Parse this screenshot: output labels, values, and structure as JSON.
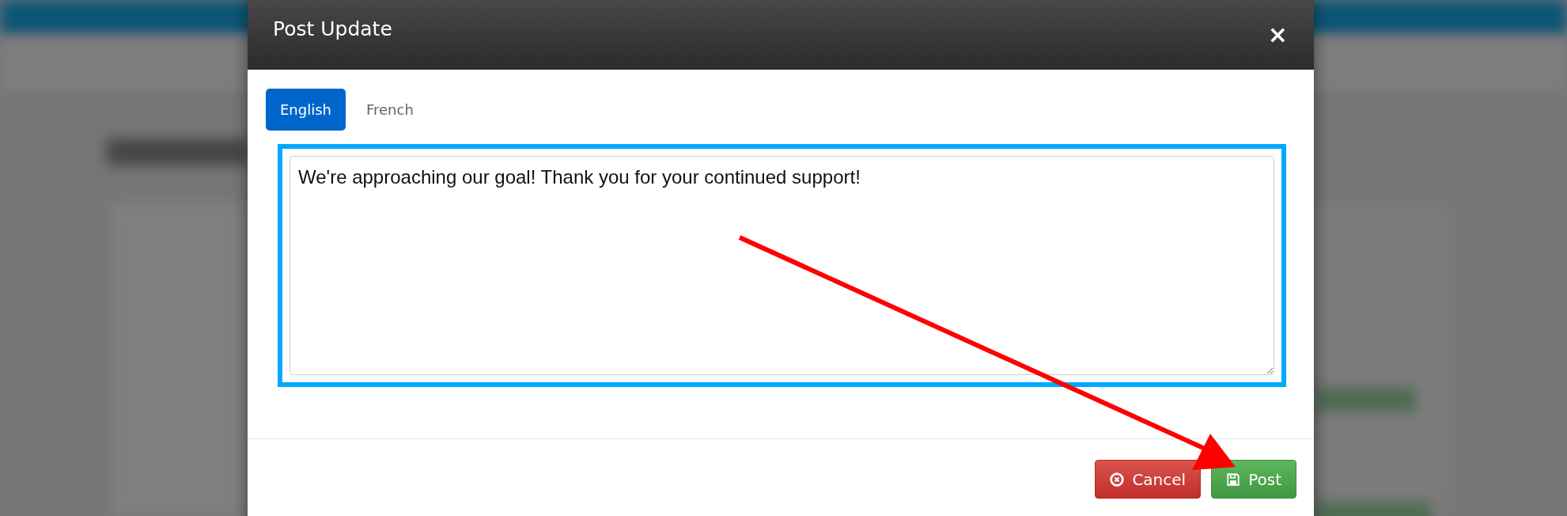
{
  "modal": {
    "title": "Post Update",
    "close": "×"
  },
  "tabs": [
    {
      "label": "English",
      "selected": true
    },
    {
      "label": "French",
      "selected": false
    }
  ],
  "editor": {
    "value": "We're approaching our goal! Thank you for your continued support!"
  },
  "buttons": [
    {
      "label": "Cancel",
      "kind": "cancel"
    },
    {
      "label": "Post",
      "kind": "post"
    }
  ]
}
